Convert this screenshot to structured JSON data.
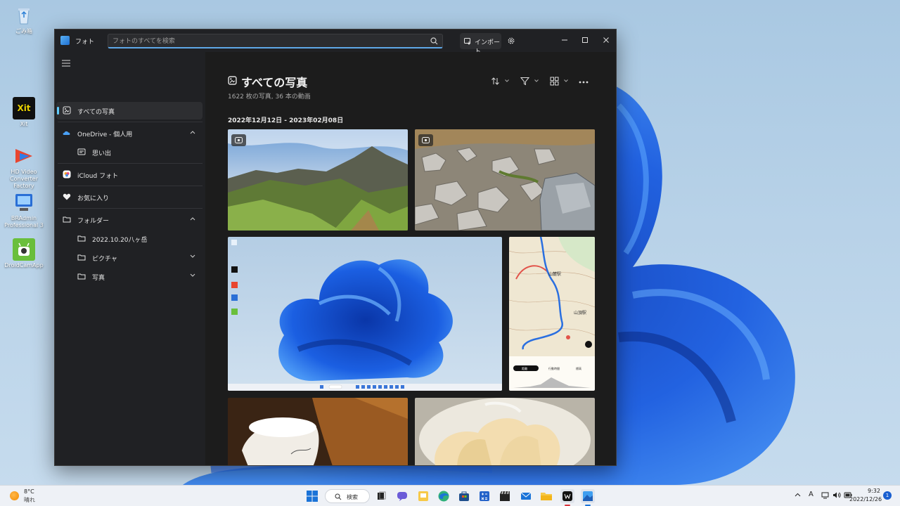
{
  "desktop": {
    "icons": [
      {
        "label": "ごみ箱"
      },
      {
        "label": "Xit"
      },
      {
        "label": "HD Video Converter Factory"
      },
      {
        "label": "BRAdmin Professional 3"
      },
      {
        "label": "DroidCamApp"
      }
    ]
  },
  "window": {
    "title": "フォト",
    "search_placeholder": "フォトのすべてを検索",
    "import_label": "インポート"
  },
  "sidebar": {
    "items": [
      {
        "label": "すべての写真",
        "icon": "photos-icon",
        "selected": true
      },
      {
        "label": "OneDrive - 個人用",
        "icon": "onedrive-icon",
        "expanded": true
      },
      {
        "label": "思い出",
        "icon": "memories-icon"
      },
      {
        "label": "iCloud フォト",
        "icon": "icloud-icon"
      },
      {
        "label": "お気に入り",
        "icon": "heart-icon"
      },
      {
        "label": "フォルダー",
        "icon": "folder-icon",
        "expanded": true
      },
      {
        "label": "2022.10.20八ヶ岳",
        "icon": "folder-icon"
      },
      {
        "label": "ピクチャ",
        "icon": "folder-icon"
      },
      {
        "label": "写真",
        "icon": "folder-icon"
      }
    ]
  },
  "main": {
    "title": "すべての写真",
    "subtitle": "1622 枚の写真, 36 本の動画",
    "date_range": "2022年12月12日 - 2023年02月08日",
    "photos": [
      {
        "name": "mountain-ridge",
        "video": true
      },
      {
        "name": "rocky-slope",
        "video": true
      },
      {
        "name": "desktop-screenshot",
        "video": false
      },
      {
        "name": "trail-map",
        "video": false
      },
      {
        "name": "cup",
        "video": false
      },
      {
        "name": "pear-slices",
        "video": false
      }
    ]
  },
  "screenshot_thumb": {
    "map_station_1": "山麓駅",
    "map_station_2": "山頂駅",
    "map_tab_1": "距離",
    "map_tab_2": "行動時間",
    "map_tab_3": "標高"
  },
  "taskbar": {
    "weather_temp": "8°C",
    "weather_desc": "晴れ",
    "search_label": "検索",
    "ime_indicator": "A",
    "time": "9:32",
    "date": "2022/12/26",
    "notifications": "1"
  },
  "colors": {
    "accent": "#60cdff",
    "window_bg": "#202124",
    "content_bg": "#1c1c1c",
    "wallpaper_blue": "#1a57d6"
  }
}
